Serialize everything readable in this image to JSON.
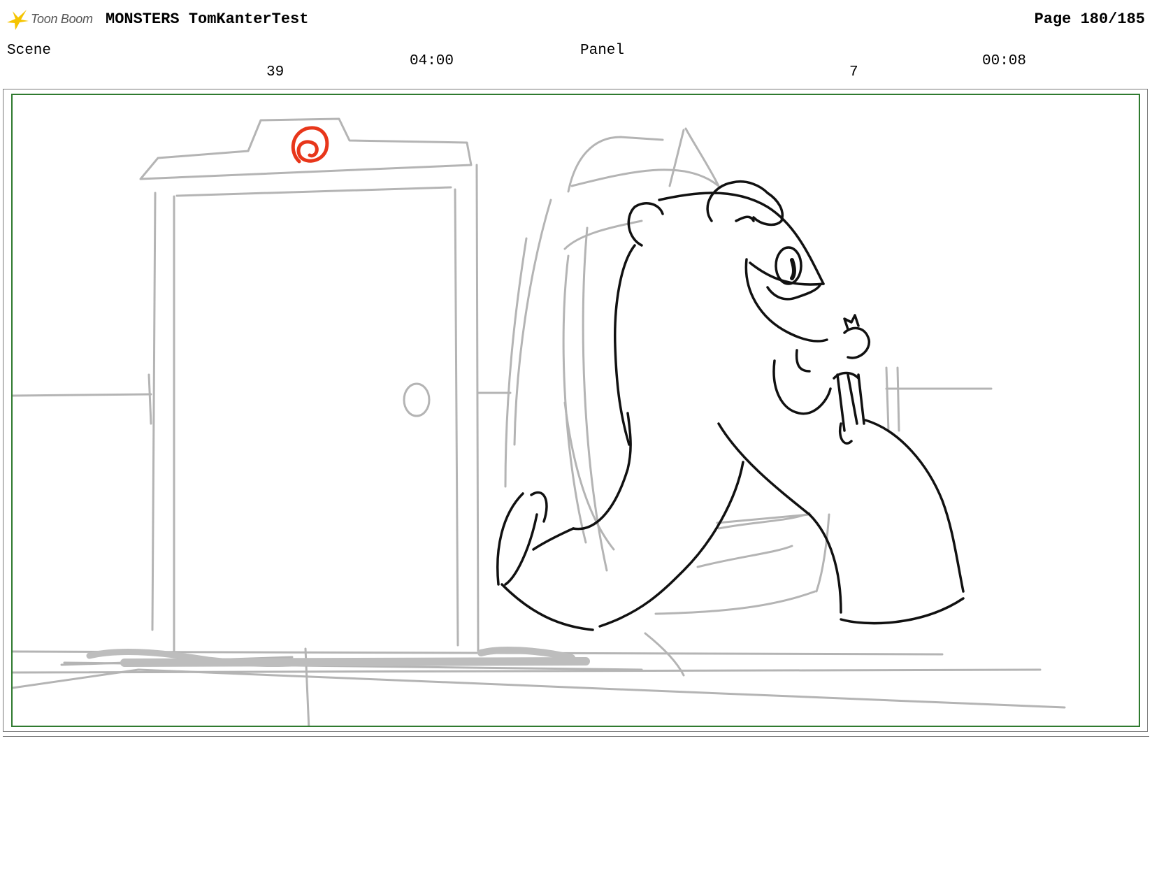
{
  "header": {
    "logo_text": "Toon Boom",
    "project_title": "MONSTERS TomKanterTest",
    "page_label": "Page 180/185"
  },
  "scene": {
    "label": "Scene",
    "number": "39",
    "duration": "04:00"
  },
  "panel": {
    "label": "Panel",
    "number": "7",
    "duration": "00:08"
  },
  "colors": {
    "frame_border": "#2f7a2f",
    "sketch_gray": "#b4b4b4",
    "sketch_black": "#111111",
    "accent_red": "#e8361a",
    "logo_yellow": "#f5c400"
  }
}
